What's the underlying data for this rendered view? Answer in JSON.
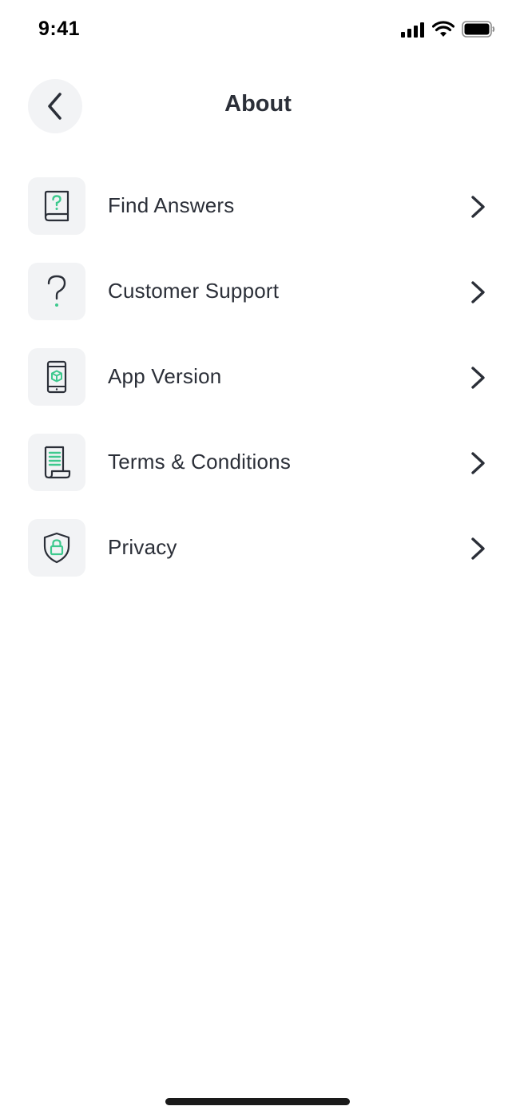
{
  "status_bar": {
    "time": "9:41"
  },
  "header": {
    "title": "About"
  },
  "menu": {
    "items": [
      {
        "label": "Find Answers",
        "icon": "help-book-icon"
      },
      {
        "label": "Customer Support",
        "icon": "question-mark-icon"
      },
      {
        "label": "App Version",
        "icon": "phone-package-icon"
      },
      {
        "label": "Terms & Conditions",
        "icon": "scroll-document-icon"
      },
      {
        "label": "Privacy",
        "icon": "shield-lock-icon"
      }
    ]
  },
  "colors": {
    "accent": "#3ec98e",
    "text": "#2b2f38",
    "tile_background": "#f2f3f5"
  }
}
